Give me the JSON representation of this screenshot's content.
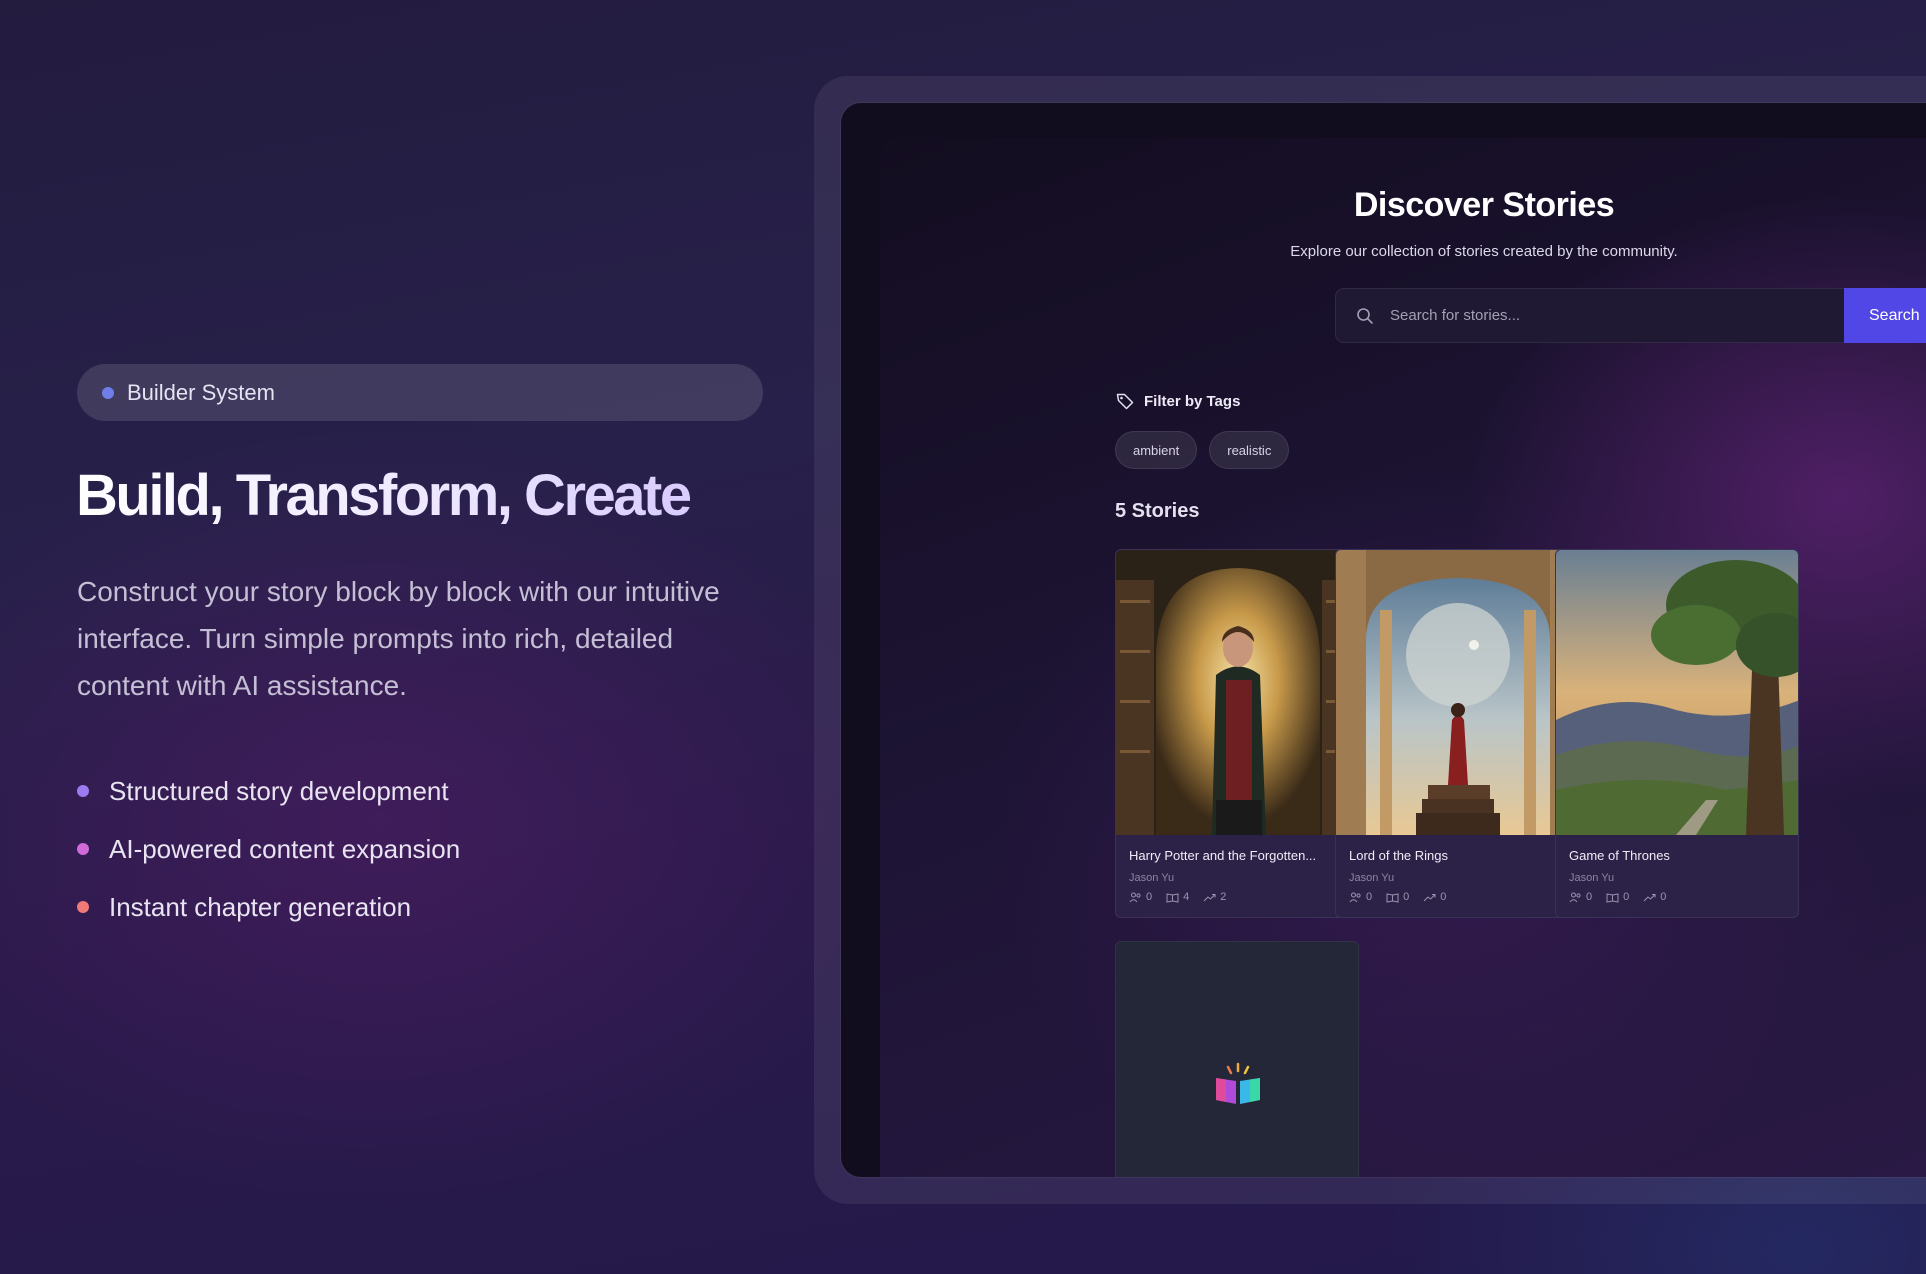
{
  "hero": {
    "badge_label": "Builder System",
    "title": "Build, Transform, Create",
    "description": "Construct your story block by block with our intuitive interface. Turn simple prompts into rich, detailed content with AI assistance.",
    "features": [
      {
        "label": "Structured story development",
        "color": "#9b7cf0"
      },
      {
        "label": "AI-powered content expansion",
        "color": "#d16ad8"
      },
      {
        "label": "Instant chapter generation",
        "color": "#f07a78"
      }
    ]
  },
  "app": {
    "title": "Discover Stories",
    "subtitle": "Explore our collection of stories created by the community.",
    "search": {
      "placeholder": "Search for stories...",
      "button_label": "Search"
    },
    "filter": {
      "label": "Filter by Tags",
      "tags": [
        "ambient",
        "realistic"
      ]
    },
    "count_label": "5 Stories",
    "stories": [
      {
        "title": "Harry Potter and the Forgotten...",
        "author": "Jason Yu",
        "stats": {
          "readers": "0",
          "chapters": "4",
          "trend": "2"
        }
      },
      {
        "title": "Lord of the Rings",
        "author": "Jason Yu",
        "stats": {
          "readers": "0",
          "chapters": "0",
          "trend": "0"
        }
      },
      {
        "title": "Game of Thrones",
        "author": "Jason Yu",
        "stats": {
          "readers": "0",
          "chapters": "0",
          "trend": "0"
        }
      }
    ]
  },
  "colors": {
    "accent": "#5146e6",
    "badge_dot": "#6f7ee8"
  },
  "icons": {
    "search": "search-icon",
    "tag": "tag-icon",
    "readers": "users-icon",
    "chapters": "book-open-icon",
    "trend": "trend-icon",
    "placeholder": "book-icon"
  }
}
